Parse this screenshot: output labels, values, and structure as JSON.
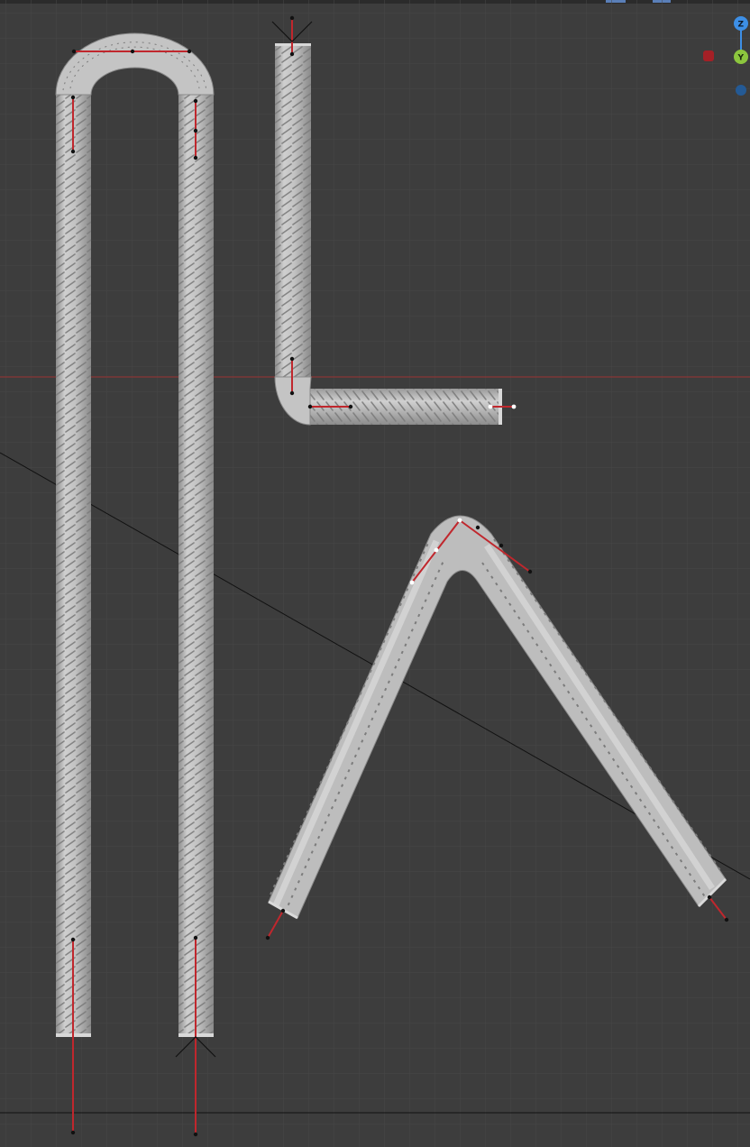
{
  "viewport": {
    "background_color": "#3d3d3d",
    "grid_color": "#4a4a4a",
    "grid_major_color": "#505050",
    "x_axis_color": "#a03a3a",
    "rebar_color": "#bdbdbd",
    "rib_color": "#7a7a7a",
    "handle_color": "#c0272d",
    "vertex_color": "#111111",
    "selected_vertex_color": "#ffffff"
  },
  "gizmo": {
    "z_label": "Z",
    "y_label": "Y",
    "z_color": "#3d8fe6",
    "y_color": "#8cc63e",
    "x_color": "#c0272d"
  },
  "objects": [
    {
      "name": "u-shaped-rebar",
      "shape": "hairpin"
    },
    {
      "name": "l-shaped-rebar",
      "shape": "90-degree-bend"
    },
    {
      "name": "v-shaped-rebar",
      "shape": "inverted-v-bend"
    }
  ]
}
